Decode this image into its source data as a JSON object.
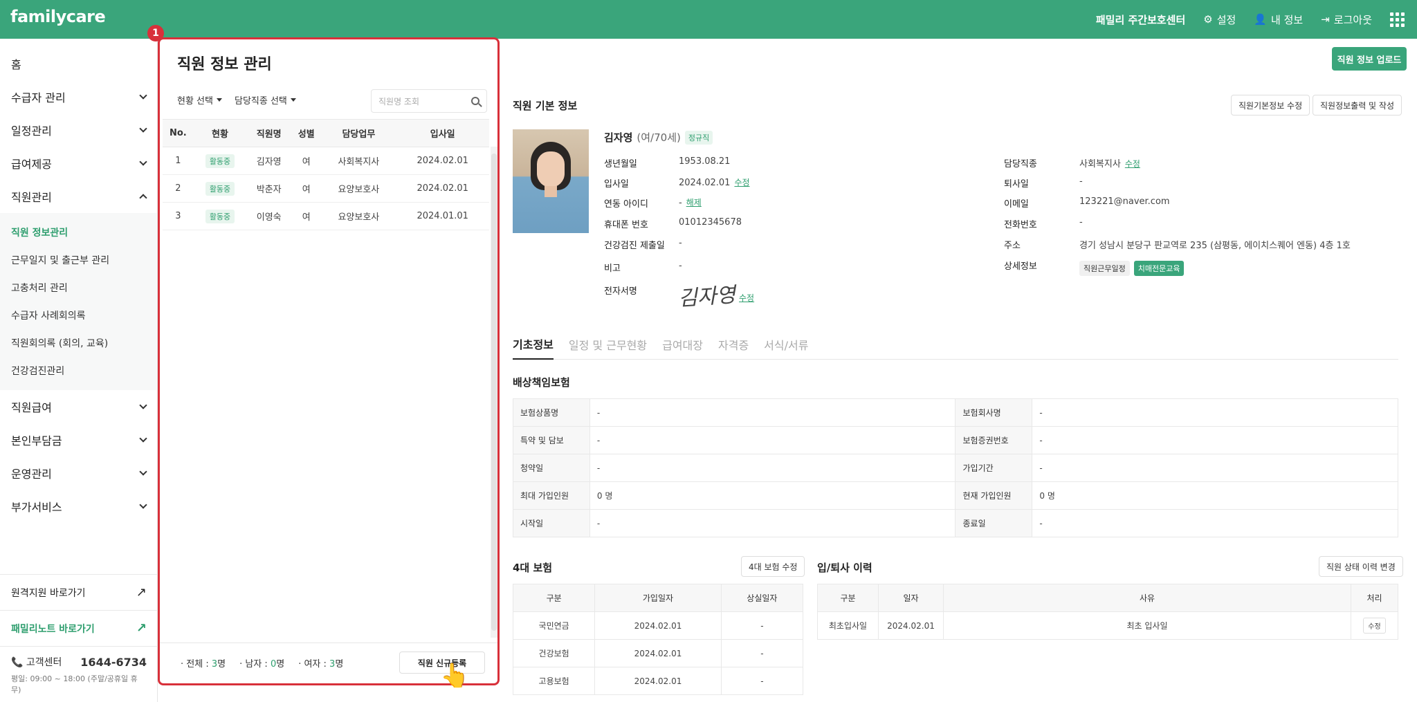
{
  "topbar": {
    "logo": "familycare",
    "center_name": "패밀리 주간보호센터",
    "settings": "설정",
    "my_info": "내 정보",
    "logout": "로그아웃"
  },
  "sidebar": {
    "home": "홈",
    "groups": [
      {
        "label": "수급자 관리"
      },
      {
        "label": "일정관리"
      },
      {
        "label": "급여제공"
      },
      {
        "label": "직원관리"
      }
    ],
    "sub_items": [
      "직원 정보관리",
      "근무일지 및 출근부 관리",
      "고충처리 관리",
      "수급자 사례회의록",
      "직원회의록 (회의, 교육)",
      "건강검진관리"
    ],
    "groups_after": [
      {
        "label": "직원급여"
      },
      {
        "label": "본인부담금"
      },
      {
        "label": "운영관리"
      },
      {
        "label": "부가서비스"
      }
    ],
    "remote_support": "원격지원 바로가기",
    "family_note": "패밀리노트 바로가기",
    "support_label": "고객센터",
    "support_phone": "1644-6734",
    "support_hours": "평일: 09:00 ~ 18:00 (주말/공휴일 휴무)"
  },
  "list_panel": {
    "badge": "1",
    "title": "직원 정보 관리",
    "filter_status": "현황 선택",
    "filter_job": "담당직종 선택",
    "search_placeholder": "직원명 조회",
    "columns": [
      "No.",
      "현황",
      "직원명",
      "성별",
      "담당업무",
      "입사일"
    ],
    "rows": [
      {
        "no": "1",
        "status": "활동중",
        "name": "김자영",
        "gender": "여",
        "job": "사회복지사",
        "date": "2024.02.01"
      },
      {
        "no": "2",
        "status": "활동중",
        "name": "박춘자",
        "gender": "여",
        "job": "요양보호사",
        "date": "2024.02.01"
      },
      {
        "no": "3",
        "status": "활동중",
        "name": "이영숙",
        "gender": "여",
        "job": "요양보호사",
        "date": "2024.01.01"
      }
    ],
    "total_label": "전체 : ",
    "total_value": "3",
    "total_unit": "명",
    "male_label": "남자 : ",
    "male_value": "0",
    "male_unit": "명",
    "female_label": "여자 : ",
    "female_value": "3",
    "female_unit": "명",
    "register_button": "직원 신규등록"
  },
  "main": {
    "upload_button": "직원 정보 업로드",
    "basic_info_title": "직원 기본 정보",
    "edit_basic_button": "직원기본정보 수정",
    "print_button": "직원정보출력 및 작성",
    "name": "김자영",
    "age": "(여/70세)",
    "employment_type": "정규직",
    "fields_left": [
      {
        "label": "생년월일",
        "value": "1953.08.21"
      },
      {
        "label": "입사일",
        "value": "2024.02.01"
      },
      {
        "label": "연동 아이디",
        "value": "-"
      },
      {
        "label": "휴대폰 번호",
        "value": "01012345678"
      },
      {
        "label": "건강검진 제출일",
        "value": "-"
      },
      {
        "label": "비고",
        "value": "-"
      },
      {
        "label": "전자서명",
        "value": ""
      }
    ],
    "edit_link": "수정",
    "unlink_link": "해제",
    "signature_text": "김자영",
    "fields_right": [
      {
        "label": "담당직종",
        "value": "사회복지사"
      },
      {
        "label": "퇴사일",
        "value": "-"
      },
      {
        "label": "이메일",
        "value": "123221@naver.com"
      },
      {
        "label": "전화번호",
        "value": "-"
      },
      {
        "label": "주소",
        "value": "경기 성남시 분당구 판교역로 235 (삼평동, 에이치스퀘어 엔동) 4층 1호"
      },
      {
        "label": "상세정보",
        "value": ""
      }
    ],
    "detail_chip_1": "직원근무일정",
    "detail_chip_2": "치매전문교육",
    "tabs": [
      "기초정보",
      "일정 및 근무현황",
      "급여대장",
      "자격증",
      "서식/서류"
    ],
    "liability_title": "배상책임보험",
    "liability_rows": [
      {
        "l1": "보험상품명",
        "v1": "-",
        "l2": "보험회사명",
        "v2": "-"
      },
      {
        "l1": "특약 및 담보",
        "v1": "-",
        "l2": "보험증권번호",
        "v2": "-"
      },
      {
        "l1": "청약일",
        "v1": "-",
        "l2": "가입기간",
        "v2": "-"
      },
      {
        "l1": "최대 가입인원",
        "v1": "0 명",
        "l2": "현재 가입인원",
        "v2": "0 명"
      },
      {
        "l1": "시작일",
        "v1": "-",
        "l2": "종료일",
        "v2": "-"
      }
    ],
    "four_ins_title": "4대 보험",
    "four_ins_edit": "4대 보험 수정",
    "four_ins_columns": [
      "구분",
      "가입일자",
      "상실일자"
    ],
    "four_ins_rows": [
      {
        "type": "국민연금",
        "join": "2024.02.01",
        "loss": "-"
      },
      {
        "type": "건강보험",
        "join": "2024.02.01",
        "loss": "-"
      },
      {
        "type": "고용보험",
        "join": "2024.02.01",
        "loss": "-"
      }
    ],
    "history_title": "입/퇴사 이력",
    "history_button": "직원 상태 이력 변경",
    "history_columns": [
      "구분",
      "일자",
      "사유",
      "처리"
    ],
    "history_rows": [
      {
        "type": "최초입사일",
        "date": "2024.02.01",
        "reason": "최초 입사일",
        "action": "수정"
      }
    ]
  }
}
